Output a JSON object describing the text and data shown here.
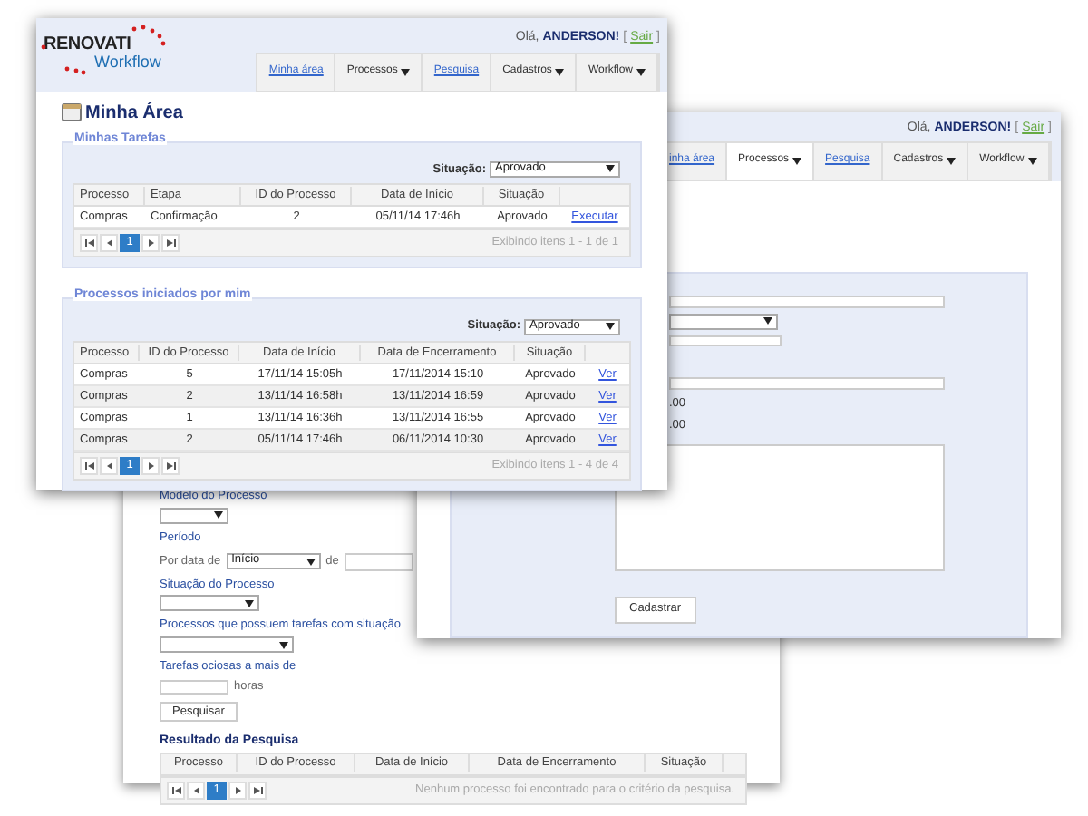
{
  "search_window": {
    "fields": [
      {
        "label": "Modelo do Processo",
        "kind": "select"
      },
      {
        "label": "Período",
        "kind": "heading"
      },
      {
        "label": "Por data de",
        "kind": "date",
        "value": "Início",
        "joiner": "de"
      },
      {
        "label": "Situação do Processo",
        "kind": "select"
      },
      {
        "label": "Processos que possuem tarefas com situação",
        "kind": "wide-select"
      },
      {
        "label": "Tarefas ociosas a mais de",
        "kind": "hours",
        "suffix": "horas"
      }
    ],
    "search_button": "Pesquisar",
    "results_title": "Resultado da Pesquisa",
    "columns": [
      "Processo",
      "ID do Processo",
      "Data de Início",
      "Data de Encerramento",
      "Situação"
    ],
    "pages": [
      {
        "label": "1",
        "selected": true
      }
    ],
    "summary": "Nenhum processo foi encontrado para o critério da pesquisa."
  },
  "form_window": {
    "greeting": "Olá,",
    "user": "ANDERSON!",
    "open_bracket": "[",
    "logout": "Sair",
    "close_bracket": "]",
    "nav": [
      {
        "label": "inha área",
        "kind": "link",
        "selected": false
      },
      {
        "label": "Processos",
        "kind": "menu",
        "selected": true
      },
      {
        "label": "Pesquisa",
        "kind": "link",
        "selected": false
      },
      {
        "label": "Cadastros",
        "kind": "menu",
        "selected": false
      },
      {
        "label": "Workflow",
        "kind": "menu",
        "selected": false
      }
    ],
    "values": [
      ".00",
      ".00"
    ],
    "submit": "Cadastrar"
  },
  "front_window": {
    "logo": {
      "brand": "RENOVATI",
      "product": "Workflow"
    },
    "greeting": "Olá,",
    "user": "ANDERSON!",
    "open_bracket": "[",
    "logout": "Sair",
    "close_bracket": "]",
    "nav": [
      {
        "label": "Minha área",
        "kind": "link",
        "selected": false
      },
      {
        "label": "Processos",
        "kind": "menu",
        "selected": false
      },
      {
        "label": "Pesquisa",
        "kind": "link",
        "selected": false
      },
      {
        "label": "Cadastros",
        "kind": "menu",
        "selected": false
      },
      {
        "label": "Workflow",
        "kind": "menu",
        "selected": false
      }
    ],
    "page_title": "Minha Área",
    "sections": [
      {
        "legend": "Minhas Tarefas",
        "filter_label": "Situação:",
        "filter_value": "Aprovado",
        "columns": [
          "Processo",
          "Etapa",
          "ID do Processo",
          "Data de Início",
          "Situação"
        ],
        "rows": [
          {
            "cells": [
              "Compras",
              "Confirmação",
              "2",
              "05/11/14 17:46h",
              "Aprovado"
            ],
            "action": "Executar"
          }
        ],
        "pages": [
          {
            "label": "1",
            "selected": true
          }
        ],
        "summary": "Exibindo itens 1 - 1 de 1"
      },
      {
        "legend": "Processos iniciados por mim",
        "filter_label": "Situação:",
        "filter_value": "Aprovado",
        "columns": [
          "Processo",
          "ID do Processo",
          "Data de Início",
          "Data de Encerramento",
          "Situação"
        ],
        "rows": [
          {
            "cells": [
              "Compras",
              "5",
              "17/11/14 15:05h",
              "17/11/2014 15:10",
              "Aprovado"
            ],
            "action": "Ver"
          },
          {
            "cells": [
              "Compras",
              "2",
              "13/11/14 16:58h",
              "13/11/2014 16:59",
              "Aprovado"
            ],
            "action": "Ver"
          },
          {
            "cells": [
              "Compras",
              "1",
              "13/11/14 16:36h",
              "13/11/2014 16:55",
              "Aprovado"
            ],
            "action": "Ver"
          },
          {
            "cells": [
              "Compras",
              "2",
              "05/11/14 17:46h",
              "06/11/2014 10:30",
              "Aprovado"
            ],
            "action": "Ver"
          }
        ],
        "pages": [
          {
            "label": "1",
            "selected": true
          }
        ],
        "summary": "Exibindo itens 1 - 4 de 4"
      }
    ]
  }
}
